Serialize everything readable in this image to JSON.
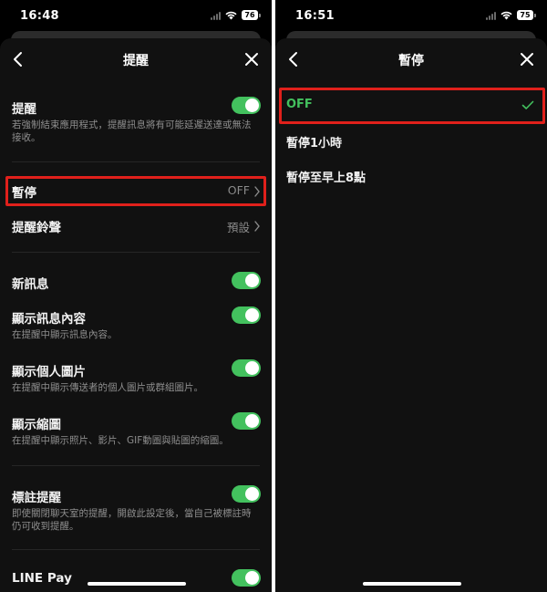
{
  "left": {
    "status": {
      "time": "16:48",
      "battery": "76"
    },
    "nav": {
      "title": "提醒"
    },
    "rows": {
      "notification": {
        "title": "提醒",
        "desc": "若強制結束應用程式，提醒訊息將有可能延遲送達或無法接收。",
        "toggle_on": true
      },
      "pause": {
        "title": "暫停",
        "value": "OFF"
      },
      "sound": {
        "title": "提醒鈴聲",
        "value": "預設"
      },
      "new_message": {
        "title": "新訊息",
        "toggle_on": true
      },
      "show_content": {
        "title": "顯示訊息內容",
        "desc": "在提醒中顯示訊息內容。",
        "toggle_on": true
      },
      "show_profile": {
        "title": "顯示個人圖片",
        "desc": "在提醒中顯示傳送者的個人圖片或群組圖片。",
        "toggle_on": true
      },
      "show_thumbnail": {
        "title": "顯示縮圖",
        "desc": "在提醒中顯示照片、影片、GIF動圖與貼圖的縮圖。",
        "toggle_on": true
      },
      "mention": {
        "title": "標註提醒",
        "desc": "即使關閉聊天室的提醒，開啟此設定後，當自己被標註時仍可收到提醒。",
        "toggle_on": true
      },
      "line_pay": {
        "title": "LINE Pay",
        "toggle_on": true
      }
    }
  },
  "right": {
    "status": {
      "time": "16:51",
      "battery": "75"
    },
    "nav": {
      "title": "暫停"
    },
    "options": [
      {
        "label": "OFF",
        "selected": true
      },
      {
        "label": "暫停1小時",
        "selected": false
      },
      {
        "label": "暫停至早上8點",
        "selected": false
      }
    ]
  },
  "colors": {
    "accent_green": "#43c15e",
    "highlight_red": "#e0201b",
    "sheet_bg": "#111111",
    "secondary_text": "#8e8e8e"
  }
}
